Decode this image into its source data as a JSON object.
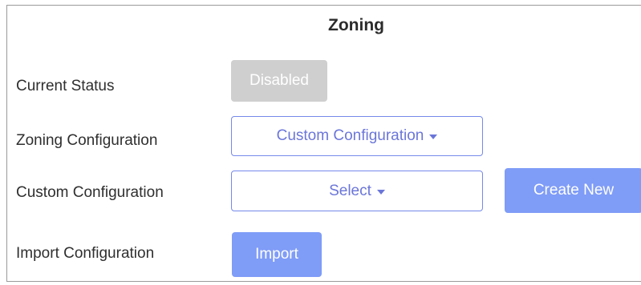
{
  "panel": {
    "title": "Zoning"
  },
  "rows": {
    "current_status": {
      "label": "Current Status",
      "value": "Disabled"
    },
    "zoning_configuration": {
      "label": "Zoning Configuration",
      "selected": "Custom Configuration"
    },
    "custom_configuration": {
      "label": "Custom Configuration",
      "selected": "Select",
      "create_label": "Create New"
    },
    "import_configuration": {
      "label": "Import Configuration",
      "button_label": "Import"
    }
  },
  "colors": {
    "accent": "#7f9cf7",
    "outline": "#7689ea",
    "disabled": "#cfcfcf"
  }
}
